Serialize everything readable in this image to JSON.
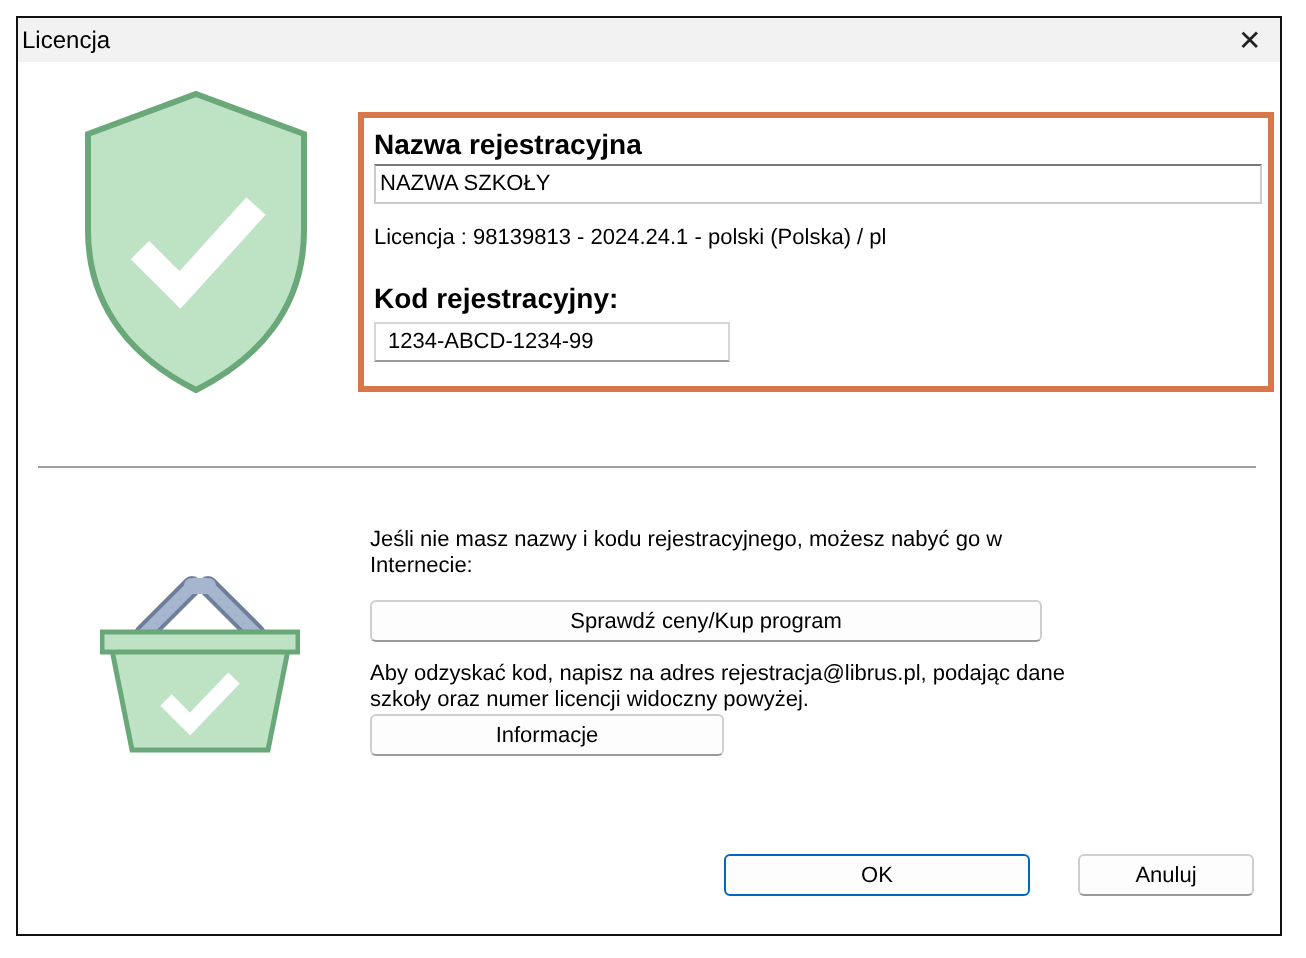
{
  "window": {
    "title": "Licencja",
    "close": "✕"
  },
  "registration": {
    "name_heading": "Nazwa rejestracyjna",
    "name_value": "NAZWA SZKOŁY",
    "license_line": "Licencja : 98139813 - 2024.24.1 - polski (Polska) / pl",
    "code_heading": "Kod rejestracyjny:",
    "code_value": "1234-ABCD-1234-99"
  },
  "purchase": {
    "text": "Jeśli nie masz nazwy i kodu rejestracyjnego, możesz nabyć go w Internecie:",
    "button": "Sprawdź ceny/Kup program"
  },
  "recovery": {
    "text": "Aby odzyskać kod, napisz na adres rejestracja@librus.pl, podając dane szkoły oraz numer licencji widoczny powyżej.",
    "button": "Informacje"
  },
  "buttons": [
    {
      "label": "OK",
      "kind": "default"
    },
    {
      "label": "Anuluj",
      "kind": "normal"
    }
  ]
}
